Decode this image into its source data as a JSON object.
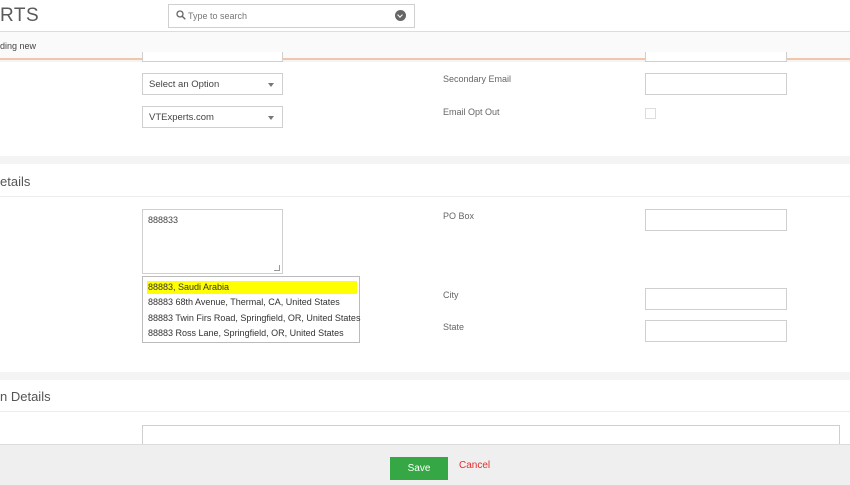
{
  "header": {
    "logo": "RTS",
    "search_placeholder": "Type to search"
  },
  "subheader": {
    "text": "ding new"
  },
  "section1": {
    "select_option": "Select an Option",
    "select_vtexperts": "VTExperts.com",
    "secondary_email_label": "Secondary Email",
    "email_opt_out_label": "Email Opt Out"
  },
  "section2": {
    "title": "etails",
    "street_value": "888833",
    "po_box_label": "PO Box",
    "city_label": "City",
    "state_label": "State",
    "suggestions": [
      "88883, Saudi Arabia",
      "88883 68th Avenue, Thermal, CA, United States",
      "88883 Twin Firs Road, Springfield, OR, United States",
      "88883 Ross Lane, Springfield, OR, United States"
    ]
  },
  "section3": {
    "title": "n Details"
  },
  "footer": {
    "save_label": "Save",
    "cancel_label": "Cancel"
  },
  "colors": {
    "save": "#35a744",
    "cancel": "#e0302e",
    "highlight": "#ffff00",
    "accent_line": "#f2c6a8"
  }
}
